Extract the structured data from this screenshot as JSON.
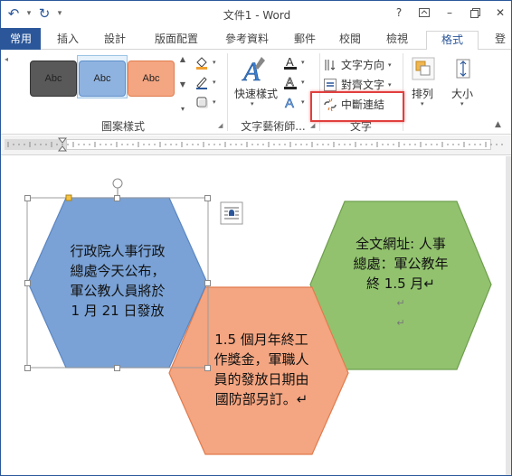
{
  "app": {
    "title": "文件1 - Word",
    "help": "?"
  },
  "qat": {
    "undo_icon": "undo-icon",
    "redo_icon": "redo-icon"
  },
  "tabs": [
    {
      "label": "常用"
    },
    {
      "label": "插入"
    },
    {
      "label": "設計"
    },
    {
      "label": "版面配置"
    },
    {
      "label": "參考資料"
    },
    {
      "label": "郵件"
    },
    {
      "label": "校閱"
    },
    {
      "label": "檢視"
    },
    {
      "label": "格式"
    },
    {
      "label": "登"
    }
  ],
  "ribbon": {
    "shape_styles": {
      "label": "圖案樣式",
      "samples": [
        {
          "text": "Abc",
          "color": "#595959"
        },
        {
          "text": "Abc",
          "color": "#8fb3e0"
        },
        {
          "text": "Abc",
          "color": "#f4a581"
        }
      ]
    },
    "wordart": {
      "label": "文字藝術師...",
      "quick_styles": "快速樣式"
    },
    "text": {
      "label": "文字",
      "direction": "文字方向",
      "align": "對齊文字",
      "break_link": "中斷連結"
    },
    "arrange": {
      "label": "排列"
    },
    "size": {
      "label": "大小"
    }
  },
  "document": {
    "hex1": [
      "行政院人事行政",
      "總處今天公布，",
      "軍公教人員將於",
      "1 月 21 日發放"
    ],
    "hex2": [
      "1.5 個月年終工",
      "作獎金，軍職人",
      "員的發放日期由",
      "國防部另訂。↵"
    ],
    "hex3": [
      "全文網址: 人事",
      "總處：軍公教年",
      "終 1.5 月↵"
    ],
    "para_mark": "↵",
    "colors": {
      "blue": "#7aa2d6",
      "orange": "#f4a581",
      "green": "#92c26e"
    }
  }
}
